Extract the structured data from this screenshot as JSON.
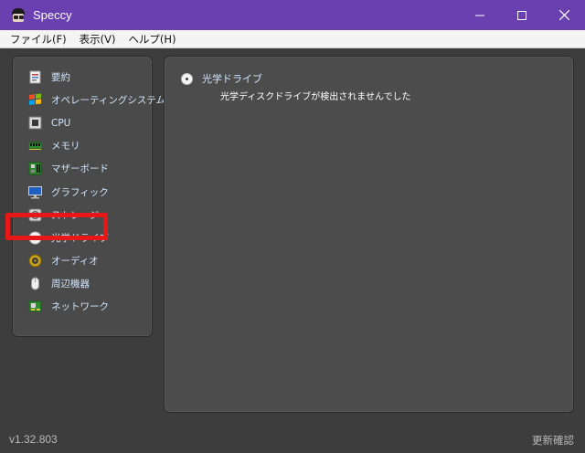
{
  "window": {
    "title": "Speccy",
    "accent": "#6a3fb0"
  },
  "menu": [
    "ファイル(F)",
    "表示(V)",
    "ヘルプ(H)"
  ],
  "sidebar": {
    "items": [
      {
        "label": "要約",
        "icon": "summary-icon"
      },
      {
        "label": "オペレーティングシステム",
        "icon": "windows-icon"
      },
      {
        "label": "CPU",
        "icon": "cpu-icon"
      },
      {
        "label": "メモリ",
        "icon": "ram-icon"
      },
      {
        "label": "マザーボード",
        "icon": "motherboard-icon"
      },
      {
        "label": "グラフィック",
        "icon": "monitor-icon"
      },
      {
        "label": "ストレージ",
        "icon": "hdd-icon"
      },
      {
        "label": "光学ドライブ",
        "icon": "optical-disc-icon"
      },
      {
        "label": "オーディオ",
        "icon": "speaker-icon"
      },
      {
        "label": "周辺機器",
        "icon": "mouse-icon"
      },
      {
        "label": "ネットワーク",
        "icon": "network-icon"
      }
    ],
    "selected_index": 7,
    "highlight_color": "#e81818"
  },
  "detail": {
    "title": "光学ドライブ",
    "message": "光学ディスクドライブが検出されませんでした"
  },
  "status": {
    "version": "v1.32.803",
    "update_check": "更新確認"
  }
}
